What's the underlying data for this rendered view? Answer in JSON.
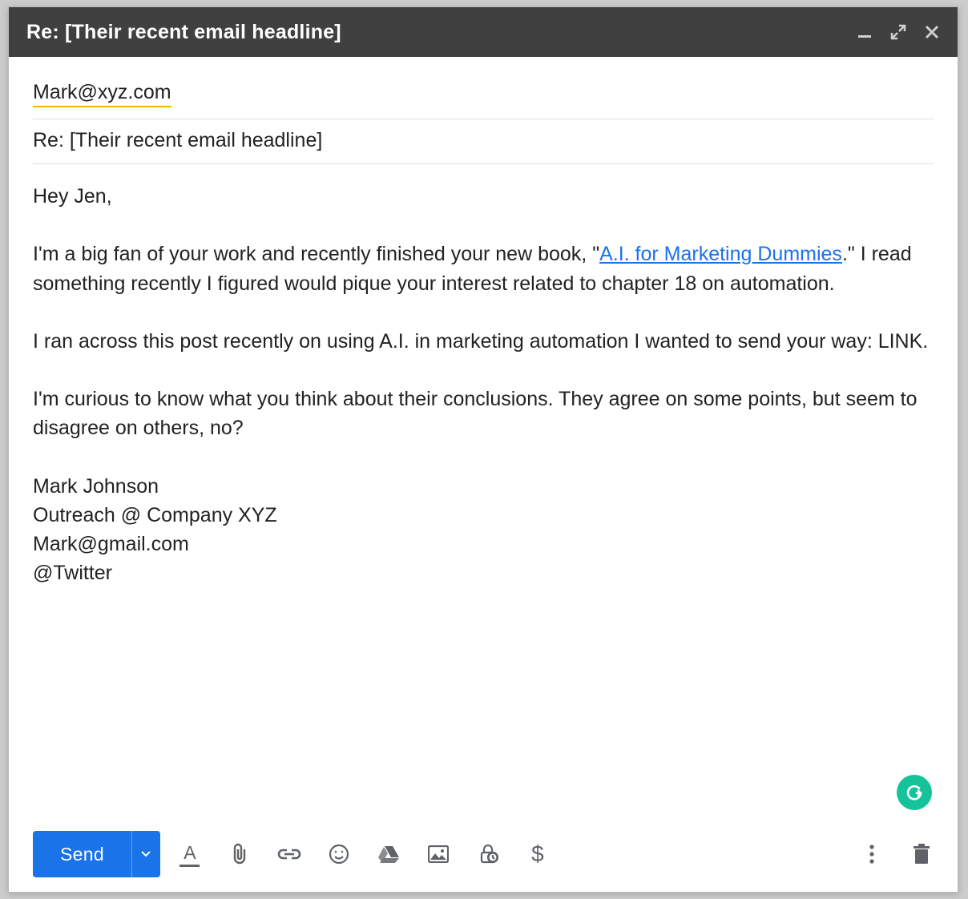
{
  "titlebar": {
    "title": "Re: [Their recent email headline]"
  },
  "fields": {
    "recipient": "Mark@xyz.com",
    "subject": "Re: [Their recent email headline]"
  },
  "body": {
    "greeting": "Hey Jen,",
    "p1_pre": "I'm a big fan of your work and recently finished your new book, \"",
    "p1_link": "A.I. for Marketing Dummies",
    "p1_post": ".\" I read something recently I figured would pique your interest related to chapter 18 on automation.",
    "p2": "I ran across this post recently on using A.I. in marketing automation I wanted to send your way: LINK.",
    "p3": "I'm curious to know what you think about their conclusions. They agree on some points, but seem to disagree on others, no?",
    "sig_name": "Mark Johnson",
    "sig_role": "Outreach @ Company XYZ",
    "sig_email": "Mark@gmail.com",
    "sig_twitter": "@Twitter"
  },
  "toolbar": {
    "send_label": "Send",
    "format_letter": "A",
    "confidential_letter": "$"
  },
  "grammarly": {
    "letter": "G"
  }
}
